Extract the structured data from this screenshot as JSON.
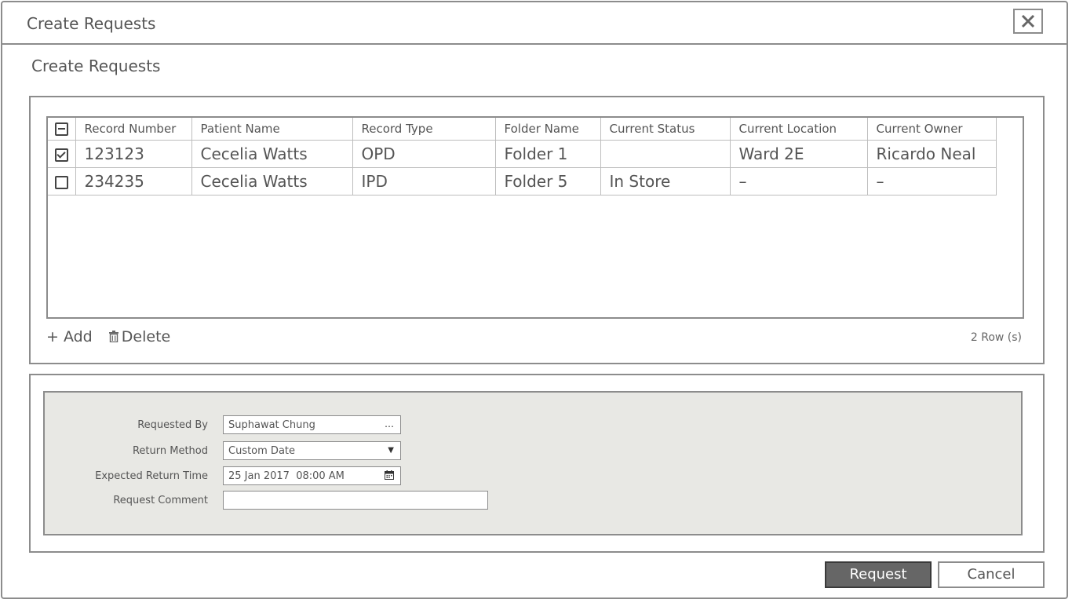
{
  "window": {
    "title": "Create Requests",
    "close_icon": "close-icon"
  },
  "page": {
    "heading": "Create Requests"
  },
  "table": {
    "columns": [
      "Record Number",
      "Patient Name",
      "Record Type",
      "Folder Name",
      "Current Status",
      "Current Location",
      "Current Owner"
    ],
    "rows": [
      {
        "checked": true,
        "record_number": "123123",
        "patient_name": "Cecelia Watts",
        "record_type": "OPD",
        "folder_name": "Folder 1",
        "current_status": "",
        "current_location": "Ward 2E",
        "current_owner": "Ricardo Neal"
      },
      {
        "checked": false,
        "record_number": "234235",
        "patient_name": "Cecelia Watts",
        "record_type": "IPD",
        "folder_name": "Folder 5",
        "current_status": "In Store",
        "current_location": "–",
        "current_owner": "–"
      }
    ],
    "add_label": "+ Add",
    "delete_label": "Delete",
    "row_count": "2 Row (s)"
  },
  "form": {
    "requested_by": {
      "label": "Requested By",
      "value": "Suphawat Chung",
      "icon": "…"
    },
    "return_method": {
      "label": "Return Method",
      "value": "Custom Date",
      "icon": "▼"
    },
    "expected_return_time": {
      "label": "Expected Return Time",
      "value": "25 Jan 2017  08:00 AM",
      "icon": "calendar-icon"
    },
    "request_comment": {
      "label": "Request Comment",
      "value": ""
    }
  },
  "footer": {
    "request_label": "Request",
    "cancel_label": "Cancel"
  }
}
